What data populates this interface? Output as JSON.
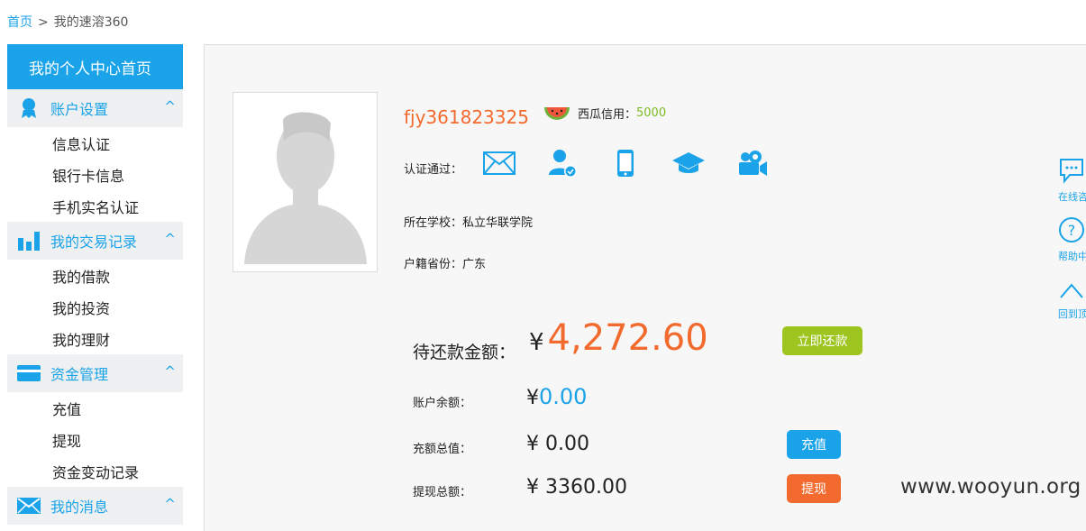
{
  "breadcrumb": {
    "home": "首页",
    "separator": ">",
    "current": "我的速溶360"
  },
  "sidebar": {
    "home": "我的个人中心首页",
    "groups": [
      {
        "title": "账户设置",
        "icon": "user-badge-icon",
        "caret": "^",
        "items": [
          "信息认证",
          "银行卡信息",
          "手机实名认证"
        ]
      },
      {
        "title": "我的交易记录",
        "icon": "bar-chart-icon",
        "caret": "^",
        "items": [
          "我的借款",
          "我的投资",
          "我的理财"
        ]
      },
      {
        "title": "资金管理",
        "icon": "card-icon",
        "caret": "^",
        "items": [
          "充值",
          "提现",
          "资金变动记录"
        ]
      },
      {
        "title": "我的消息",
        "icon": "mail-icon",
        "caret": "^",
        "items": []
      }
    ]
  },
  "profile": {
    "username": "fjy361823325",
    "credit_label": "西瓜信用：",
    "credit_value": "5000",
    "verify_label": "认证通过：",
    "verify_icons": [
      "email-verified-icon",
      "identity-verified-icon",
      "phone-verified-icon",
      "education-verified-icon",
      "video-verified-icon"
    ],
    "school": "所在学校：私立华联学院",
    "province": "户籍省份：广东"
  },
  "finance": {
    "due_label": "待还款金额：",
    "due_currency": "¥",
    "due_amount": "4,272.60",
    "repay_button": "立即还款",
    "balance_label": "账户余额：",
    "balance_currency": "¥",
    "balance_value": "0.00",
    "recharge_total_label": "充额总值：",
    "recharge_total_value": "¥ 0.00",
    "recharge_button": "充值",
    "withdraw_total_label": "提现总额：",
    "withdraw_total_value": "¥ 3360.00",
    "withdraw_button": "提现"
  },
  "side_tools": [
    {
      "label": "在线咨",
      "icon": "chat-icon"
    },
    {
      "label": "帮助中",
      "icon": "help-icon"
    },
    {
      "label": "回到顶",
      "icon": "back-to-top-icon"
    }
  ],
  "watermark": "www.wooyun.org",
  "colors": {
    "accent": "#1aa3e8",
    "orange": "#f26a2e",
    "green": "#9ec51f",
    "credit_green": "#7dbb24"
  }
}
